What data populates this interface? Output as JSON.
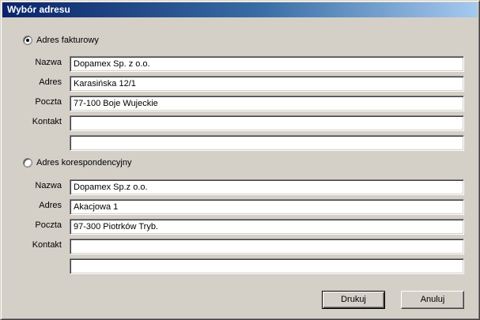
{
  "window": {
    "title": "Wybór adresu"
  },
  "billing": {
    "option_label": "Adres fakturowy",
    "selected": true,
    "labels": {
      "name": "Nazwa",
      "address": "Adres",
      "post": "Poczta",
      "contact": "Kontakt"
    },
    "values": {
      "name": "Dopamex Sp. z o.o.",
      "address": "Karasińska 12/1",
      "post": "77-100 Boje Wujeckie",
      "contact": "",
      "contact2": ""
    }
  },
  "correspondence": {
    "option_label": "Adres korespondencyjny",
    "selected": false,
    "labels": {
      "name": "Nazwa",
      "address": "Adres",
      "post": "Poczta",
      "contact": "Kontakt"
    },
    "values": {
      "name": "Dopamex Sp.z o.o.",
      "address": "Akacjowa 1",
      "post": " 97-300 Piotrków Tryb.",
      "contact": "",
      "contact2": ""
    }
  },
  "buttons": {
    "print": "Drukuj",
    "cancel": "Anuluj"
  }
}
